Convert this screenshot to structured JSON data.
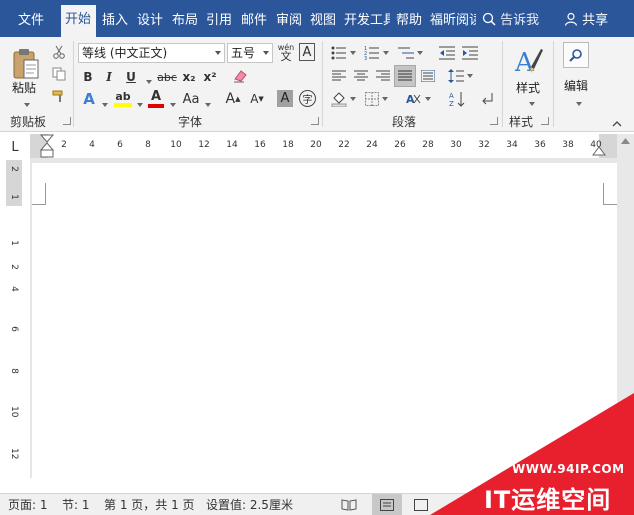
{
  "tabs": [
    "文件",
    "开始",
    "插入",
    "设计",
    "布局",
    "引用",
    "邮件",
    "审阅",
    "视图",
    "开发工具",
    "帮助",
    "福昕阅读器"
  ],
  "active_tab": "开始",
  "tell_me": "告诉我",
  "share": "共享",
  "clipboard": {
    "paste_label": "粘贴",
    "group_label": "剪贴板"
  },
  "font": {
    "font_name": "等线 (中文正文)",
    "font_size": "五号",
    "wen_top": "wén",
    "wen_bottom": "文",
    "char_border": "A",
    "bold": "B",
    "italic": "I",
    "underline": "U",
    "strike": "abc",
    "subscript": "x₂",
    "superscript": "x²",
    "text_effect": "A",
    "highlight": "ab",
    "font_color": "A",
    "change_case": "Aa",
    "grow": "A",
    "shrink": "A",
    "char_shading": "A",
    "enclosed": "字",
    "group_label": "字体"
  },
  "paragraph": {
    "group_label": "段落"
  },
  "styles": {
    "label": "样式",
    "group_label": "样式"
  },
  "editing": {
    "label": "编辑"
  },
  "ruler": {
    "corner": "L",
    "h_numbers": [
      "2",
      "4",
      "6",
      "8",
      "10",
      "12",
      "14",
      "16",
      "18",
      "20",
      "22",
      "24",
      "26",
      "28",
      "30",
      "32",
      "34",
      "36",
      "38",
      "40"
    ],
    "v_numbers": [
      "2",
      "1",
      "1",
      "2",
      "4",
      "6",
      "8",
      "10",
      "12"
    ]
  },
  "status": {
    "page": "页面: 1",
    "section": "节: 1",
    "page_count": "第 1 页，共 1 页",
    "setting": "设置值: 2.5厘米"
  },
  "watermark": {
    "url": "WWW.94IP.COM",
    "title": "IT运维空间"
  },
  "colors": {
    "ribbon_blue": "#2b579a",
    "highlight_yellow": "#ffff00",
    "font_red": "#e00000",
    "watermark_red": "#e8202e"
  }
}
